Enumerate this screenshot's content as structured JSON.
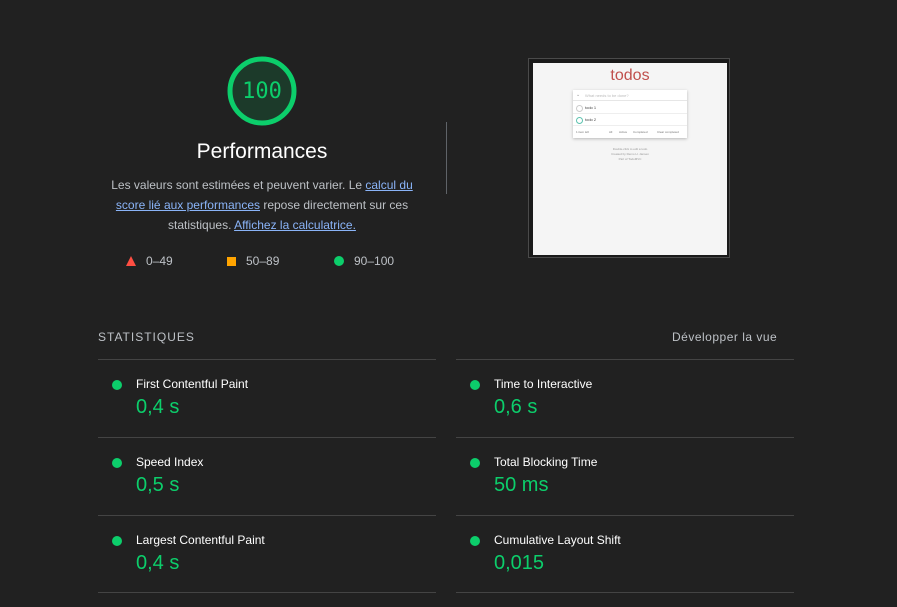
{
  "score": {
    "value": "100",
    "category": "Performances",
    "color": "#0cce6b"
  },
  "description": {
    "text_before": "Les valeurs sont estimées et peuvent varier. Le ",
    "link1": "calcul du score lié aux performances",
    "text_middle": " repose directement sur ces statistiques. ",
    "link2": "Affichez la calculatrice."
  },
  "legend": [
    {
      "label": "0–49",
      "icon": "red-triangle-icon",
      "color": "#ff4e42"
    },
    {
      "label": "50–89",
      "icon": "orange-square-icon",
      "color": "#ffa400"
    },
    {
      "label": "90–100",
      "icon": "green-circle-icon",
      "color": "#0cce6b"
    }
  ],
  "thumbnail": {
    "title": "todos",
    "input_placeholder": "What needs to be done?",
    "items": [
      "todo 1",
      "todo 2"
    ],
    "footer": {
      "count": "1 item left",
      "filters": [
        "All",
        "Active",
        "Completed"
      ],
      "clear": "Clear completed"
    },
    "info": [
      "Double-click to edit a todo",
      "Created by Remo H. Jansen",
      "Part of TodoMVC"
    ]
  },
  "metrics_section": {
    "label": "STATISTIQUES",
    "expand_label": "Développer la vue"
  },
  "metrics": [
    {
      "title": "First Contentful Paint",
      "value": "0,4 s"
    },
    {
      "title": "Time to Interactive",
      "value": "0,6 s"
    },
    {
      "title": "Speed Index",
      "value": "0,5 s"
    },
    {
      "title": "Total Blocking Time",
      "value": "50 ms"
    },
    {
      "title": "Largest Contentful Paint",
      "value": "0,4 s"
    },
    {
      "title": "Cumulative Layout Shift",
      "value": "0,015"
    }
  ]
}
